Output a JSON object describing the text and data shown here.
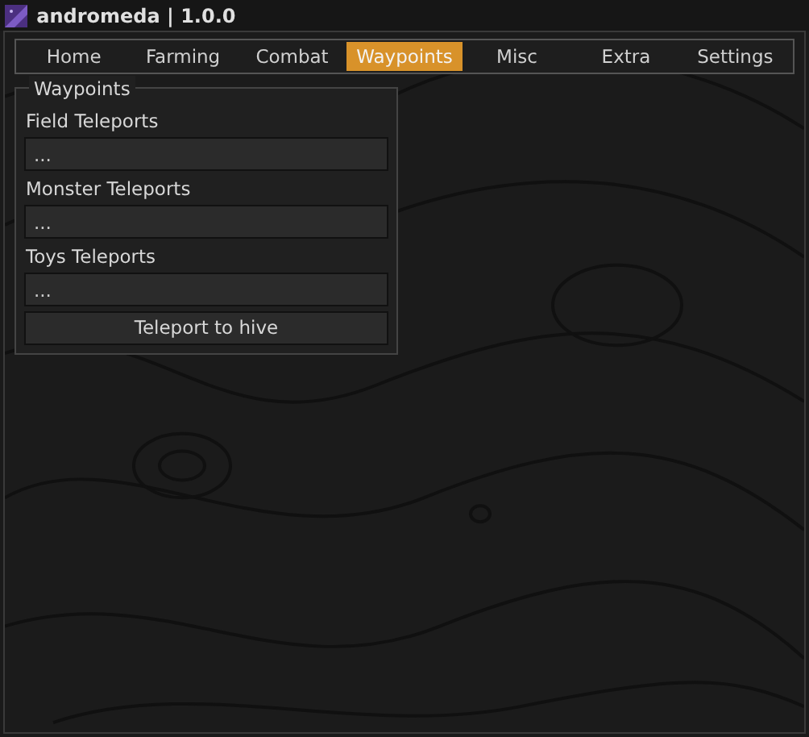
{
  "window": {
    "title": "andromeda | 1.0.0"
  },
  "tabs": [
    {
      "label": "Home",
      "selected": false
    },
    {
      "label": "Farming",
      "selected": false
    },
    {
      "label": "Combat",
      "selected": false
    },
    {
      "label": "Waypoints",
      "selected": true
    },
    {
      "label": "Misc",
      "selected": false
    },
    {
      "label": "Extra",
      "selected": false
    },
    {
      "label": "Settings",
      "selected": false
    }
  ],
  "group": {
    "title": "Waypoints",
    "items": [
      {
        "kind": "dropdown",
        "label": "Field Teleports",
        "value": "..."
      },
      {
        "kind": "dropdown",
        "label": "Monster Teleports",
        "value": "..."
      },
      {
        "kind": "dropdown",
        "label": "Toys Teleports",
        "value": "..."
      },
      {
        "kind": "button",
        "label": "Teleport to hive"
      }
    ]
  }
}
